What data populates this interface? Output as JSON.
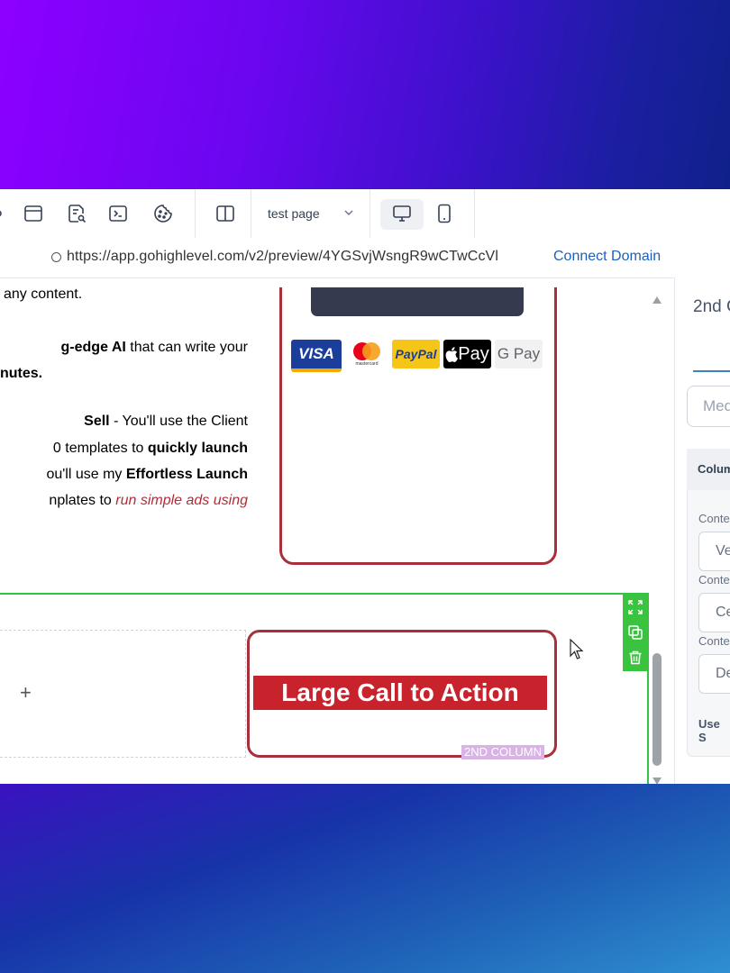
{
  "toolbar": {
    "page_name": "test page",
    "icons": [
      "layout-icon",
      "search-page-icon",
      "code-icon",
      "cookie-icon",
      "columns-icon",
      "chevron-down-icon",
      "desktop-icon",
      "mobile-icon"
    ]
  },
  "urlbar": {
    "url": "https://app.gohighlevel.com/v2/preview/4YGSvjWsngR9wCTwCcVl",
    "connect_label": "Connect Domain"
  },
  "content": {
    "line1": "any content.",
    "line2_bold": "g-edge AI",
    "line2_rest": " that can write your",
    "line3_bold": "nutes.",
    "line4_bold": "Sell",
    "line4_rest": " - You'll use the Client",
    "line5_a": "0 templates to ",
    "line5_bold": "quickly launch",
    "line6_a": "ou'll use my ",
    "line6_bold": "Effortless Launch",
    "line7_a": "nplates to ",
    "line7_italic": "run simple ads using"
  },
  "payment_logos": {
    "visa": "VISA",
    "mastercard": "mastercard",
    "paypal": "PayPal",
    "applepay": "Pay",
    "gpay": "G Pay"
  },
  "section": {
    "plus": "+",
    "cta_label": "Large Call to Action",
    "column_tag": "2ND COLUMN"
  },
  "panel": {
    "title": "2nd C",
    "input_placeholder": "Med",
    "group_head": "Colum",
    "labels": [
      "Conte",
      "Conte",
      "Conte"
    ],
    "boxes": [
      "Ve",
      "Ce",
      "De"
    ],
    "use_label": "Use S"
  },
  "colors": {
    "accent": "#1d5fbf",
    "card_border": "#a8303a",
    "cta_red": "#c8232d",
    "section_green": "#35c24b"
  }
}
